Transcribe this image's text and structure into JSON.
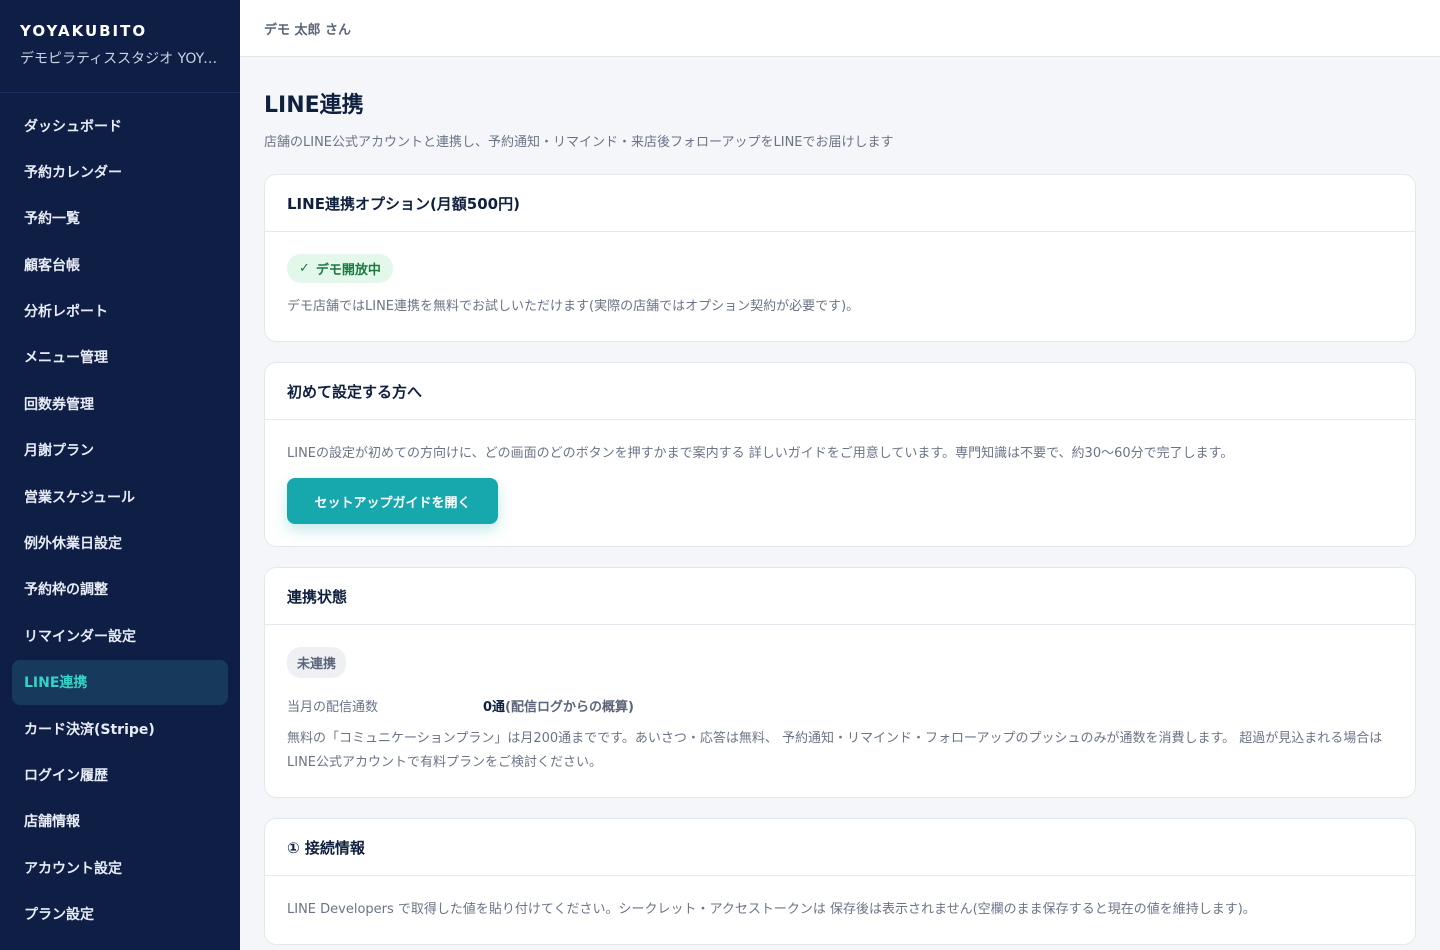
{
  "brand": {
    "name": "YOYAKUBITO",
    "store": "デモピラティススタジオ YOYAKUBITO"
  },
  "nav": {
    "items": [
      {
        "label": "ダッシュボード"
      },
      {
        "label": "予約カレンダー"
      },
      {
        "label": "予約一覧"
      },
      {
        "label": "顧客台帳"
      },
      {
        "label": "分析レポート"
      },
      {
        "label": "メニュー管理"
      },
      {
        "label": "回数券管理"
      },
      {
        "label": "月謝プラン"
      },
      {
        "label": "営業スケジュール"
      },
      {
        "label": "例外休業日設定"
      },
      {
        "label": "予約枠の調整"
      },
      {
        "label": "リマインダー設定"
      },
      {
        "label": "LINE連携",
        "active": true
      },
      {
        "label": "カード決済(Stripe)"
      },
      {
        "label": "ログイン履歴"
      },
      {
        "label": "店舗情報"
      },
      {
        "label": "アカウント設定"
      },
      {
        "label": "プラン設定"
      }
    ]
  },
  "header": {
    "user": "デモ 太郎 さん"
  },
  "page": {
    "title": "LINE連携",
    "subtitle": "店舗のLINE公式アカウントと連携し、予約通知・リマインド・来店後フォローアップをLINEでお届けします"
  },
  "option_card": {
    "title": "LINE連携オプション(月額500円)",
    "badge": "デモ開放中",
    "note": "デモ店舗ではLINE連携を無料でお試しいただけます(実際の店舗ではオプション契約が必要です)。"
  },
  "guide_card": {
    "title": "初めて設定する方へ",
    "note": "LINEの設定が初めての方向けに、どの画面のどのボタンを押すかまで案内する 詳しいガイドをご用意しています。専門知識は不要で、約30〜60分で完了します。",
    "button": "セットアップガイドを開く"
  },
  "status_card": {
    "title": "連携状態",
    "status": "未連携",
    "delivery_label": "当月の配信通数",
    "delivery_value": "0通",
    "delivery_note": "(配信ログからの概算)",
    "note": "無料の「コミュニケーションプラン」は月200通までです。あいさつ・応答は無料、 予約通知・リマインド・フォローアップのプッシュのみが通数を消費します。 超過が見込まれる場合はLINE公式アカウントで有料プランをご検討ください。"
  },
  "connection_card": {
    "title": "① 接続情報",
    "note": "LINE Developers で取得した値を貼り付けてください。シークレット・アクセストークンは 保存後は表示されません(空欄のまま保存すると現在の値を維持します)。"
  },
  "colors": {
    "sidebar": "#0e1e44",
    "accent": "#16a8ad",
    "active_text": "#34d3c6"
  }
}
